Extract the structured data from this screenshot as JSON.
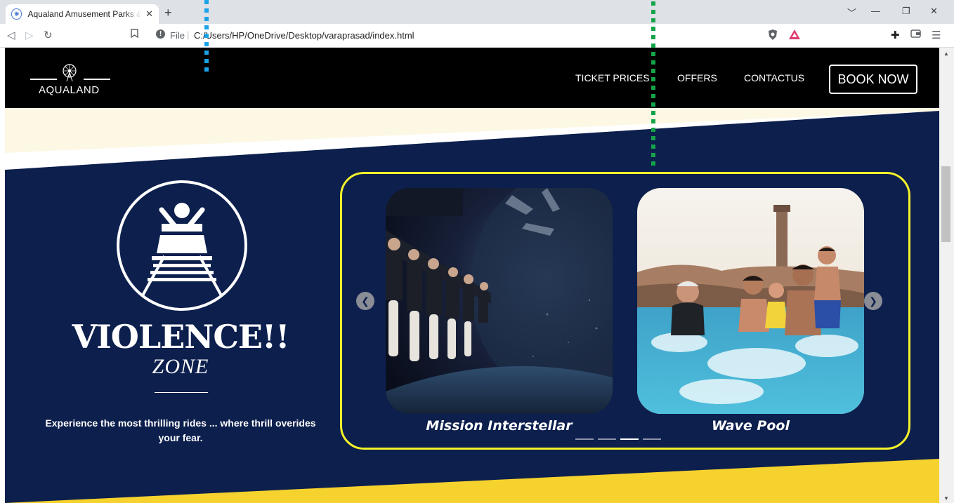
{
  "browser": {
    "tab_title": "Aqualand Amusement Parks & Resorts",
    "tab_close": "✕",
    "new_tab": "+",
    "scheme_label": "File",
    "separator": "|",
    "url": "C:/Users/HP/OneDrive/Desktop/varaprasad/index.html",
    "window_controls": [
      "﹀",
      "—",
      "❐",
      "✕"
    ]
  },
  "site": {
    "logo_text": "AQUALAND",
    "nav": [
      "TICKET PRICES",
      "OFFERS",
      "CONTACTUS"
    ],
    "book_now": "BOOK NOW"
  },
  "zone": {
    "title": "VIOLENCE!!",
    "subtitle": "ZONE",
    "description": "Experience the most thrilling rides ... where thrill overides your fear."
  },
  "carousel": {
    "slides": [
      {
        "caption": "Mission Interstellar"
      },
      {
        "caption": "Wave Pool"
      }
    ],
    "indicator_count": 4,
    "active_indicator": 2
  },
  "colors": {
    "navy": "#0c1f4d",
    "cream": "#fdf8e4",
    "yellow": "#f5d22d",
    "highlight_yellow": "#f4f22a",
    "marker_blue": "#1aa3e8",
    "marker_green": "#15a34a"
  }
}
